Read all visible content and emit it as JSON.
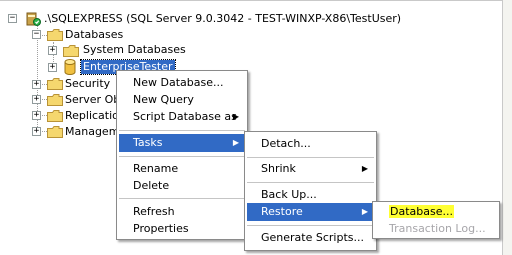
{
  "tree": {
    "server_label": ".\\SQLEXPRESS (SQL Server 9.0.3042 - TEST-WINXP-X86\\TestUser)",
    "databases_label": "Databases",
    "system_databases_label": "System Databases",
    "selected_database_label": "EnterpriseTester",
    "security_label": "Security",
    "server_objects_label": "Server Ob",
    "replication_label": "Replication",
    "management_label": "Manageme",
    "expand_glyph": "+",
    "collapse_glyph": "−"
  },
  "context_menu": {
    "new_database": "New Database...",
    "new_query": "New Query",
    "script_database_as": "Script Database as",
    "tasks": "Tasks",
    "rename": "Rename",
    "delete": "Delete",
    "refresh": "Refresh",
    "properties": "Properties"
  },
  "tasks_menu": {
    "detach": "Detach...",
    "shrink": "Shrink",
    "back_up": "Back Up...",
    "restore": "Restore",
    "generate_scripts": "Generate Scripts..."
  },
  "restore_menu": {
    "database": "Database...",
    "transaction_log": "Transaction Log..."
  },
  "submenu_arrow": "▶",
  "colors": {
    "selection": "#316ac5",
    "folder": "#f5d76e",
    "highlight_yellow": "#ffff33"
  }
}
